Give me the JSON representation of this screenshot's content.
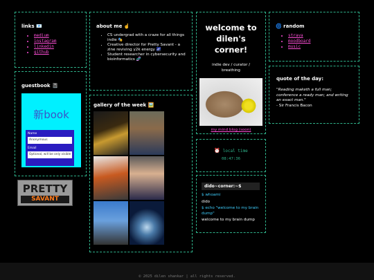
{
  "links": {
    "title": "links",
    "title_icon": "📧",
    "items": [
      "medium",
      "instagram",
      "linkedin",
      "github"
    ]
  },
  "guestbook": {
    "title": "guestbook",
    "title_icon": "📓",
    "logo": "新book",
    "name_label": "Name",
    "name_value": "Anonymous",
    "email_label": "Email",
    "email_placeholder": "Optional, will be only visible to you"
  },
  "badge": {
    "line1": "PRETTY",
    "line2": "SAVANT"
  },
  "about": {
    "title": "about me",
    "title_icon": "☝️",
    "items": [
      "CS undergrad with a craze for all things indie 🎭",
      "Creative director for Pretty Savant - a zine reviving y2k energy 🌌",
      "Student researcher in cybersecurity and bioinformatics 🧬"
    ]
  },
  "gallery": {
    "title": "gallery of the week",
    "title_icon": "🖼️"
  },
  "welcome": {
    "title": "welcome to dilen's corner!",
    "subtitle": "indie dev / curator / breathing",
    "blog_link": "my mind blog (soon)"
  },
  "local_time": {
    "label": "local time",
    "icon": "⏰",
    "value": "08:47:36"
  },
  "terminal": {
    "prompt": "dido~corner:~$",
    "lines": [
      {
        "text": "$ whoami",
        "color": "#3fd0ff"
      },
      {
        "text": "dido",
        "color": "#ffffff"
      },
      {
        "text": "$ echo \"welcome to my brain dump\"",
        "color": "#3fd0ff"
      },
      {
        "text": "welcome to my brain dump",
        "color": "#ffffff"
      }
    ]
  },
  "random": {
    "title": "random",
    "title_icon": "🌀",
    "items": [
      "strava",
      "moodboard",
      "music"
    ]
  },
  "quote": {
    "title": "quote of the day:",
    "text": "\"Reading maketh a full man; conference a ready man; and writing an exact man.\"",
    "author": "- Sir Francis Bacon"
  },
  "footer": {
    "text": "© 2025 dilen shankar | all rights reserved."
  },
  "colors": {
    "accent": "#2fb58c",
    "link": "#ff4fd8",
    "cyan": "#3fd0ff"
  }
}
